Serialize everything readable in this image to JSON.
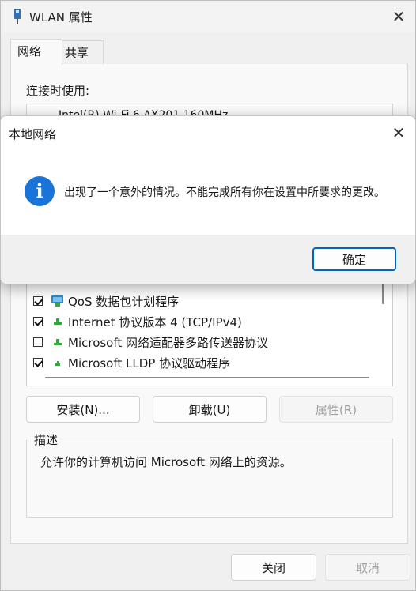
{
  "window": {
    "title": "WLAN 属性",
    "tabs": [
      {
        "label": "网络"
      },
      {
        "label": "共享"
      }
    ],
    "connect_using_label": "连接时使用:",
    "adapter_name": "Intel(R) Wi-Fi 6 AX201 160MHz",
    "components": [
      {
        "label": "QoS 数据包计划程序",
        "checked": true
      },
      {
        "label": "Internet 协议版本 4 (TCP/IPv4)",
        "checked": true
      },
      {
        "label": "Microsoft 网络适配器多路传送器协议",
        "checked": false
      },
      {
        "label": "Microsoft LLDP 协议驱动程序",
        "checked": true
      }
    ],
    "buttons": {
      "install": "安装(N)...",
      "uninstall": "卸载(U)",
      "properties": "属性(R)"
    },
    "description_label": "描述",
    "description_text": "允许你的计算机访问 Microsoft 网络上的资源。",
    "footer": {
      "close": "关闭",
      "cancel": "取消"
    }
  },
  "dialog": {
    "title": "本地网络",
    "message": "出现了一个意外的情况。不能完成所有你在设置中所要求的更改。",
    "ok_label": "确定"
  },
  "colors": {
    "accent": "#0067c0",
    "info_icon": "#1a73d9"
  }
}
